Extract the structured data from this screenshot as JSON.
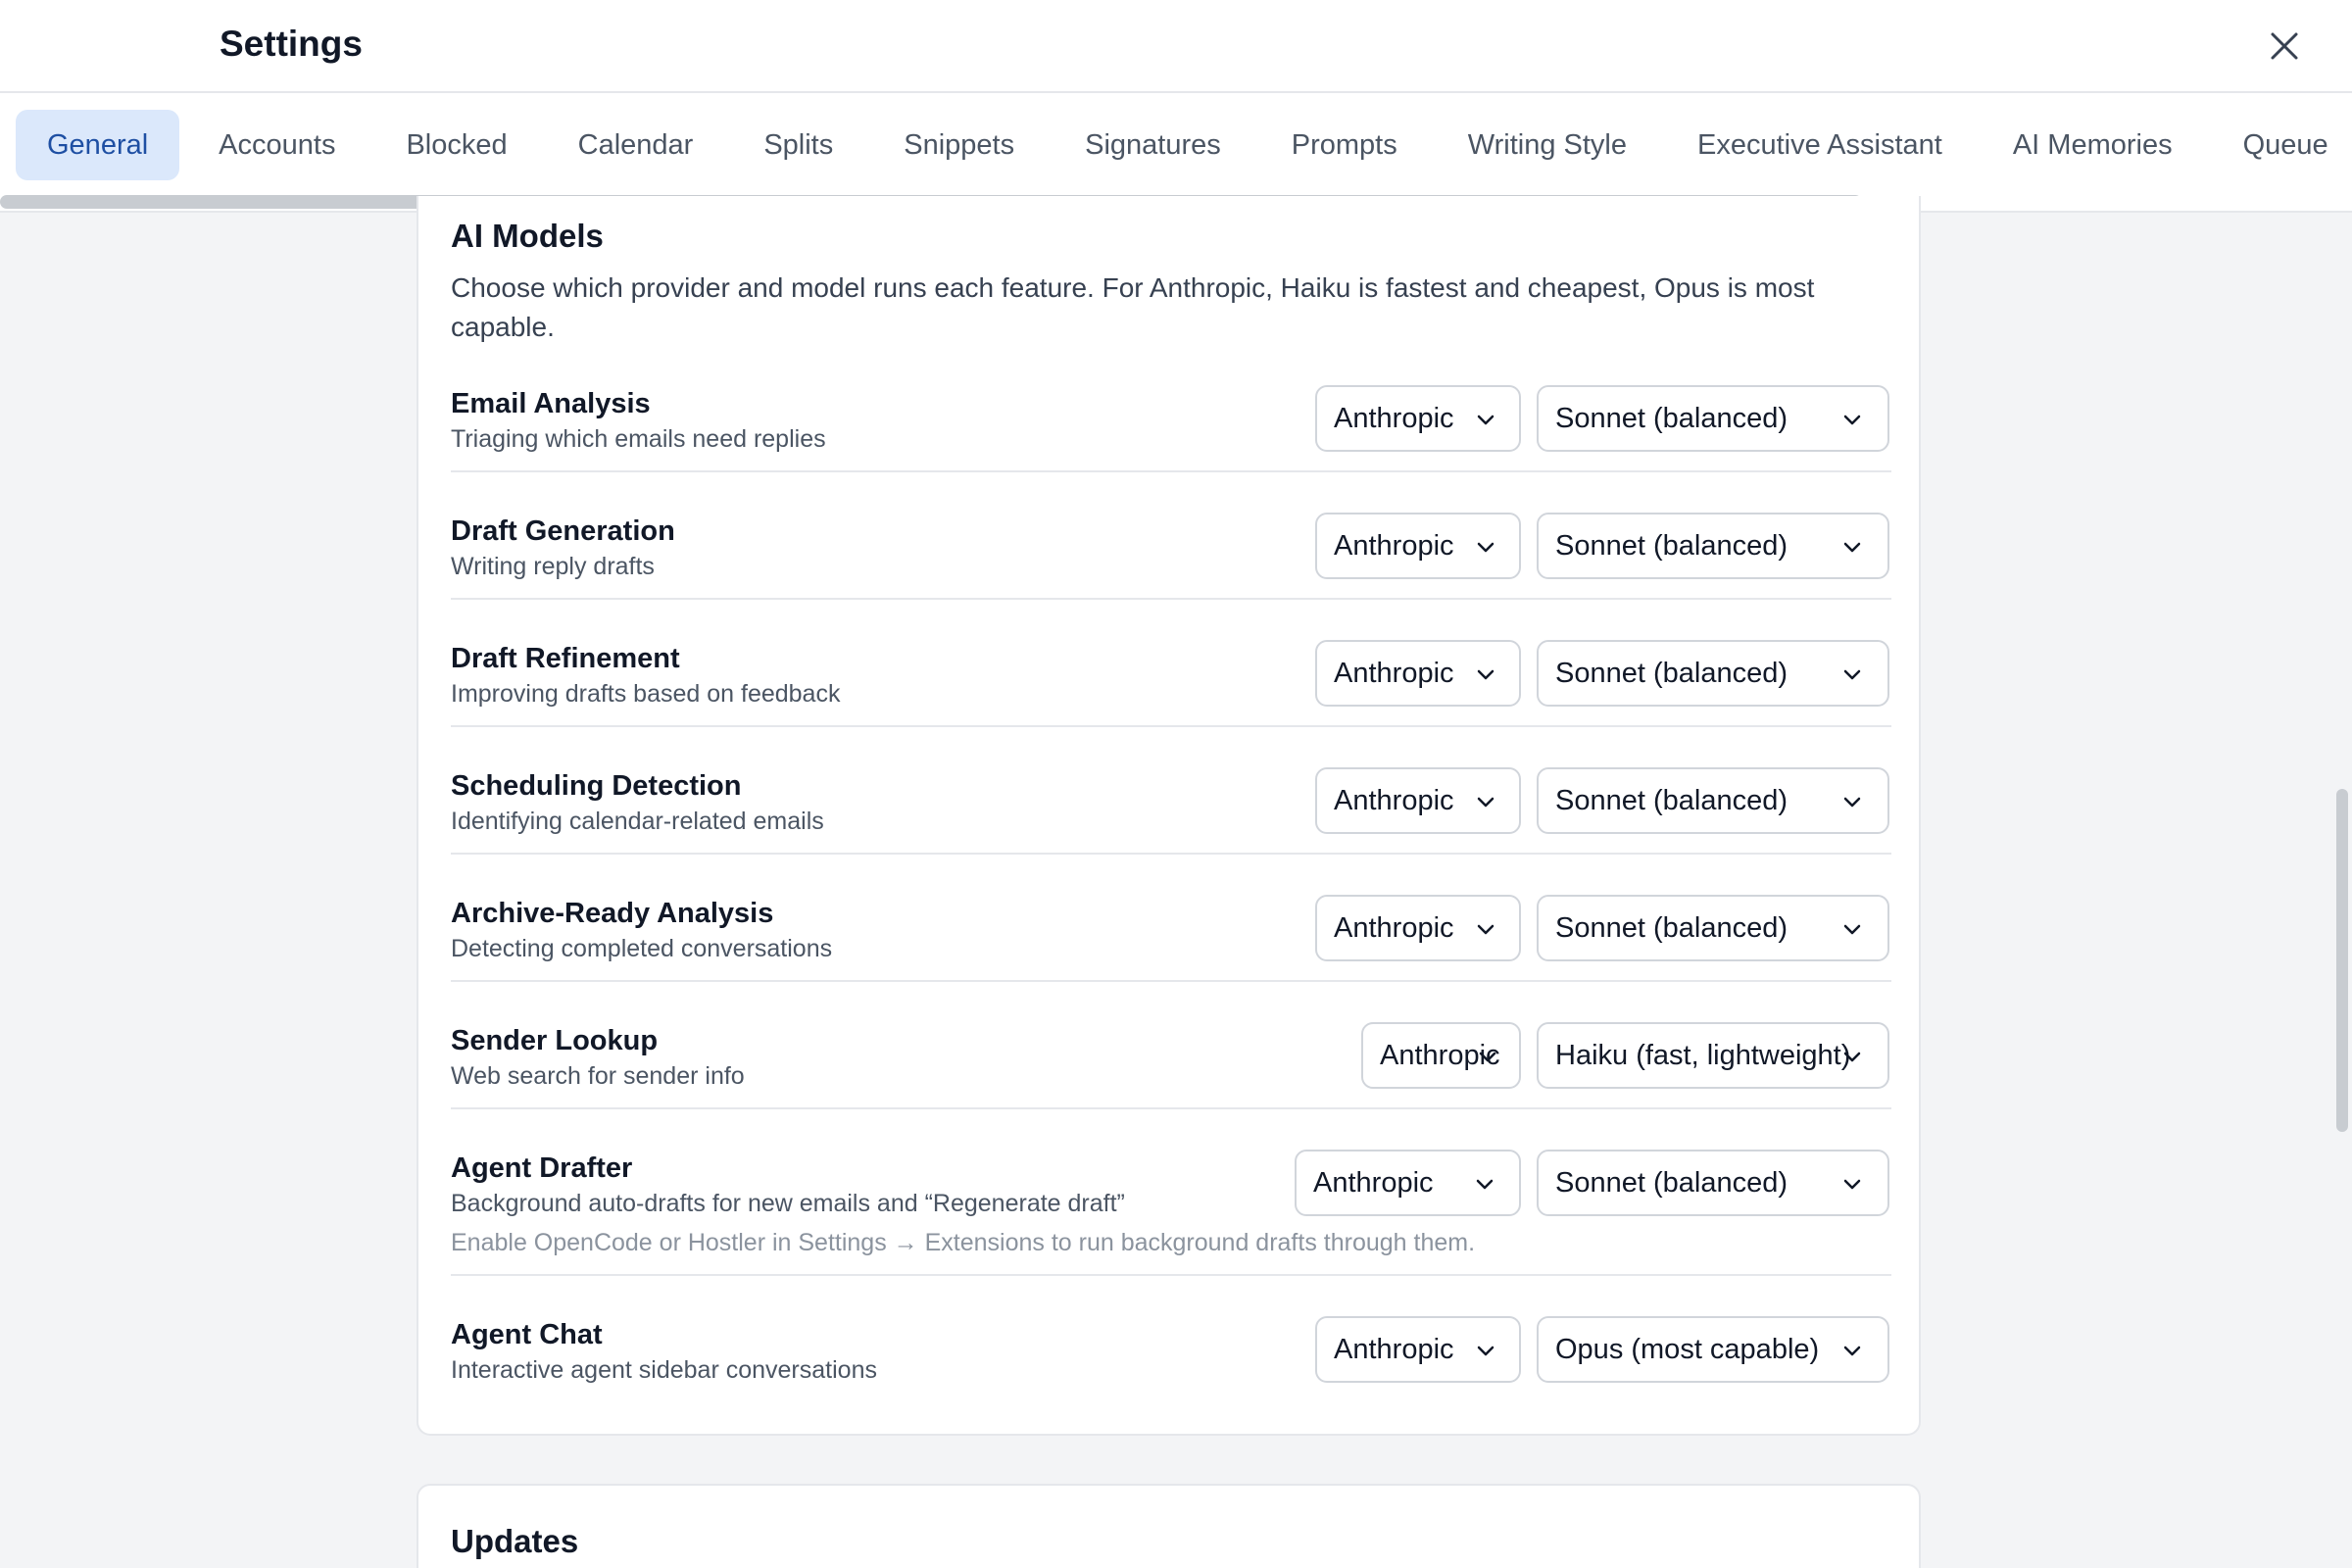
{
  "header": {
    "title": "Settings"
  },
  "tabs": [
    {
      "label": "General",
      "active": true
    },
    {
      "label": "Accounts"
    },
    {
      "label": "Blocked"
    },
    {
      "label": "Calendar"
    },
    {
      "label": "Splits"
    },
    {
      "label": "Snippets"
    },
    {
      "label": "Signatures"
    },
    {
      "label": "Prompts"
    },
    {
      "label": "Writing Style"
    },
    {
      "label": "Executive Assistant"
    },
    {
      "label": "AI Memories"
    },
    {
      "label": "Queue"
    }
  ],
  "ai_models": {
    "title": "AI Models",
    "description": "Choose which provider and model runs each feature. For Anthropic, Haiku is fastest and cheapest, Opus is most capable.",
    "rows": [
      {
        "label": "Email Analysis",
        "sub": "Triaging which emails need replies",
        "provider": "Anthropic",
        "model": "Sonnet (balanced)"
      },
      {
        "label": "Draft Generation",
        "sub": "Writing reply drafts",
        "provider": "Anthropic",
        "model": "Sonnet (balanced)"
      },
      {
        "label": "Draft Refinement",
        "sub": "Improving drafts based on feedback",
        "provider": "Anthropic",
        "model": "Sonnet (balanced)"
      },
      {
        "label": "Scheduling Detection",
        "sub": "Identifying calendar-related emails",
        "provider": "Anthropic",
        "model": "Sonnet (balanced)"
      },
      {
        "label": "Archive-Ready Analysis",
        "sub": "Detecting completed conversations",
        "provider": "Anthropic",
        "model": "Sonnet (balanced)"
      },
      {
        "label": "Sender Lookup",
        "sub": "Web search for sender info",
        "provider": "Anthropic",
        "model": "Haiku (fast, lightweight)"
      },
      {
        "label": "Agent Drafter",
        "sub": "Background auto-drafts for new emails and “Regenerate draft”",
        "hint": "Enable OpenCode or Hostler in Settings → Extensions to run background drafts through them.",
        "provider": "Anthropic",
        "model": "Sonnet (balanced)"
      },
      {
        "label": "Agent Chat",
        "sub": "Interactive agent sidebar conversations",
        "provider": "Anthropic",
        "model": "Opus (most capable)"
      }
    ]
  },
  "updates": {
    "title": "Updates"
  },
  "icons": {
    "close": "close-icon",
    "chevron": "chevron-down-icon"
  }
}
